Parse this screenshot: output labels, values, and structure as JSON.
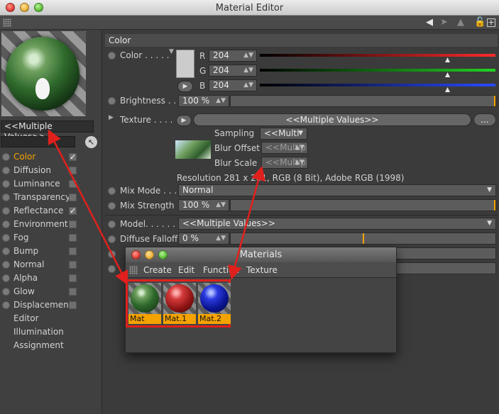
{
  "window": {
    "title": "Material Editor"
  },
  "left": {
    "multiple_values": "<<Multiple Values>>",
    "channels": [
      {
        "label": "Color",
        "dots": ". . . . .",
        "checked": true,
        "active": true
      },
      {
        "label": "Diffusion",
        "dots": ". . .",
        "checked": false,
        "active": false
      },
      {
        "label": "Luminance",
        "dots": ". .",
        "checked": false,
        "active": false
      },
      {
        "label": "Transparency",
        "dots": "",
        "checked": false,
        "active": false
      },
      {
        "label": "Reflectance",
        "dots": ". .",
        "checked": true,
        "active": false
      },
      {
        "label": "Environment",
        "dots": "",
        "checked": false,
        "active": false
      },
      {
        "label": "Fog",
        "dots": ". . . . . . . .",
        "checked": false,
        "active": false
      },
      {
        "label": "Bump",
        "dots": ". . . . . . .",
        "checked": false,
        "active": false
      },
      {
        "label": "Normal",
        "dots": ". . . . . .",
        "checked": false,
        "active": false
      },
      {
        "label": "Alpha",
        "dots": ". . . . . . .",
        "checked": false,
        "active": false
      },
      {
        "label": "Glow",
        "dots": ". . . . . . .",
        "checked": false,
        "active": false
      },
      {
        "label": "Displacement",
        "dots": "",
        "checked": false,
        "active": false
      }
    ],
    "extra": [
      "Editor",
      "Illumination",
      "Assignment"
    ]
  },
  "color_section": {
    "header": "Color",
    "color_label": "Color . . . . .",
    "r_label": "R",
    "g_label": "G",
    "b_label": "B",
    "r": "204",
    "g": "204",
    "b": "204",
    "brightness_label": "Brightness . . . .",
    "brightness": "100 %",
    "texture_label": "Texture . . . . .",
    "texture_value": "<<Multiple Values>>",
    "more_btn": "...",
    "sampling_label": "Sampling",
    "sampling_value": "<<Multi",
    "blur_offset_label": "Blur Offset",
    "blur_offset_value": "<<Multip",
    "blur_scale_label": "Blur Scale",
    "blur_scale_value": "<<Multip",
    "resolution": "Resolution 281 x 281, RGB (8 Bit), Adobe RGB (1998)",
    "mix_mode_label": "Mix Mode . . .",
    "mix_mode_value": "Normal",
    "mix_strength_label": "Mix Strength",
    "mix_strength_value": "100 %",
    "model_label": "Model. . . . . . .",
    "model_value": "<<Multiple Values>>",
    "diffuse_falloff_label": "Diffuse Falloff",
    "diffuse_falloff_value": "0 %",
    "colors": {
      "accent": "#f5a300",
      "red": "#ff2a2a",
      "green": "#22d322",
      "blue": "#2a4aff",
      "arrow": "#e0201c"
    }
  },
  "materials_window": {
    "title": "Materials",
    "menu": [
      "Create",
      "Edit",
      "Function",
      "Texture"
    ],
    "items": [
      {
        "name": "Mat",
        "kind": "textured"
      },
      {
        "name": "Mat.1",
        "kind": "red"
      },
      {
        "name": "Mat.2",
        "kind": "blue"
      }
    ]
  }
}
